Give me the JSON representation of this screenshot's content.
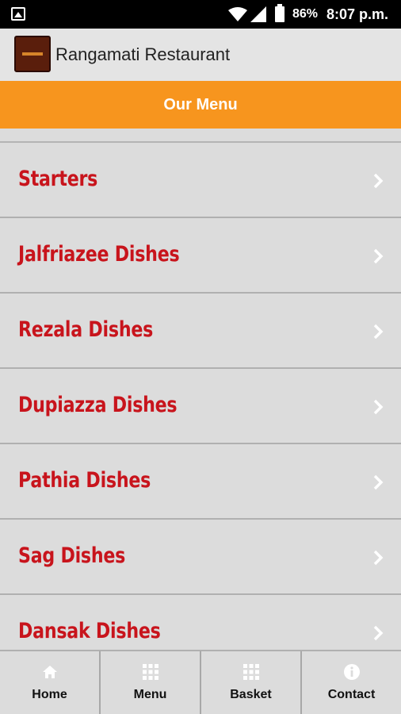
{
  "status_bar": {
    "battery": "86%",
    "time": "8:07 p.m."
  },
  "app_bar": {
    "title": "Rangamati Restaurant"
  },
  "header": {
    "title": "Our Menu"
  },
  "menu_items": [
    {
      "label": "Starters"
    },
    {
      "label": "Jalfriazee Dishes"
    },
    {
      "label": "Rezala Dishes"
    },
    {
      "label": "Dupiazza Dishes"
    },
    {
      "label": "Pathia Dishes"
    },
    {
      "label": "Sag Dishes"
    },
    {
      "label": "Dansak Dishes"
    }
  ],
  "bottom_nav": [
    {
      "label": "Home",
      "icon": "home-icon"
    },
    {
      "label": "Menu",
      "icon": "grid-icon"
    },
    {
      "label": "Basket",
      "icon": "grid-icon"
    },
    {
      "label": "Contact",
      "icon": "info-icon"
    }
  ],
  "colors": {
    "accent": "#f7951e",
    "item_text": "#c8141c",
    "background": "#dcdcdc"
  }
}
